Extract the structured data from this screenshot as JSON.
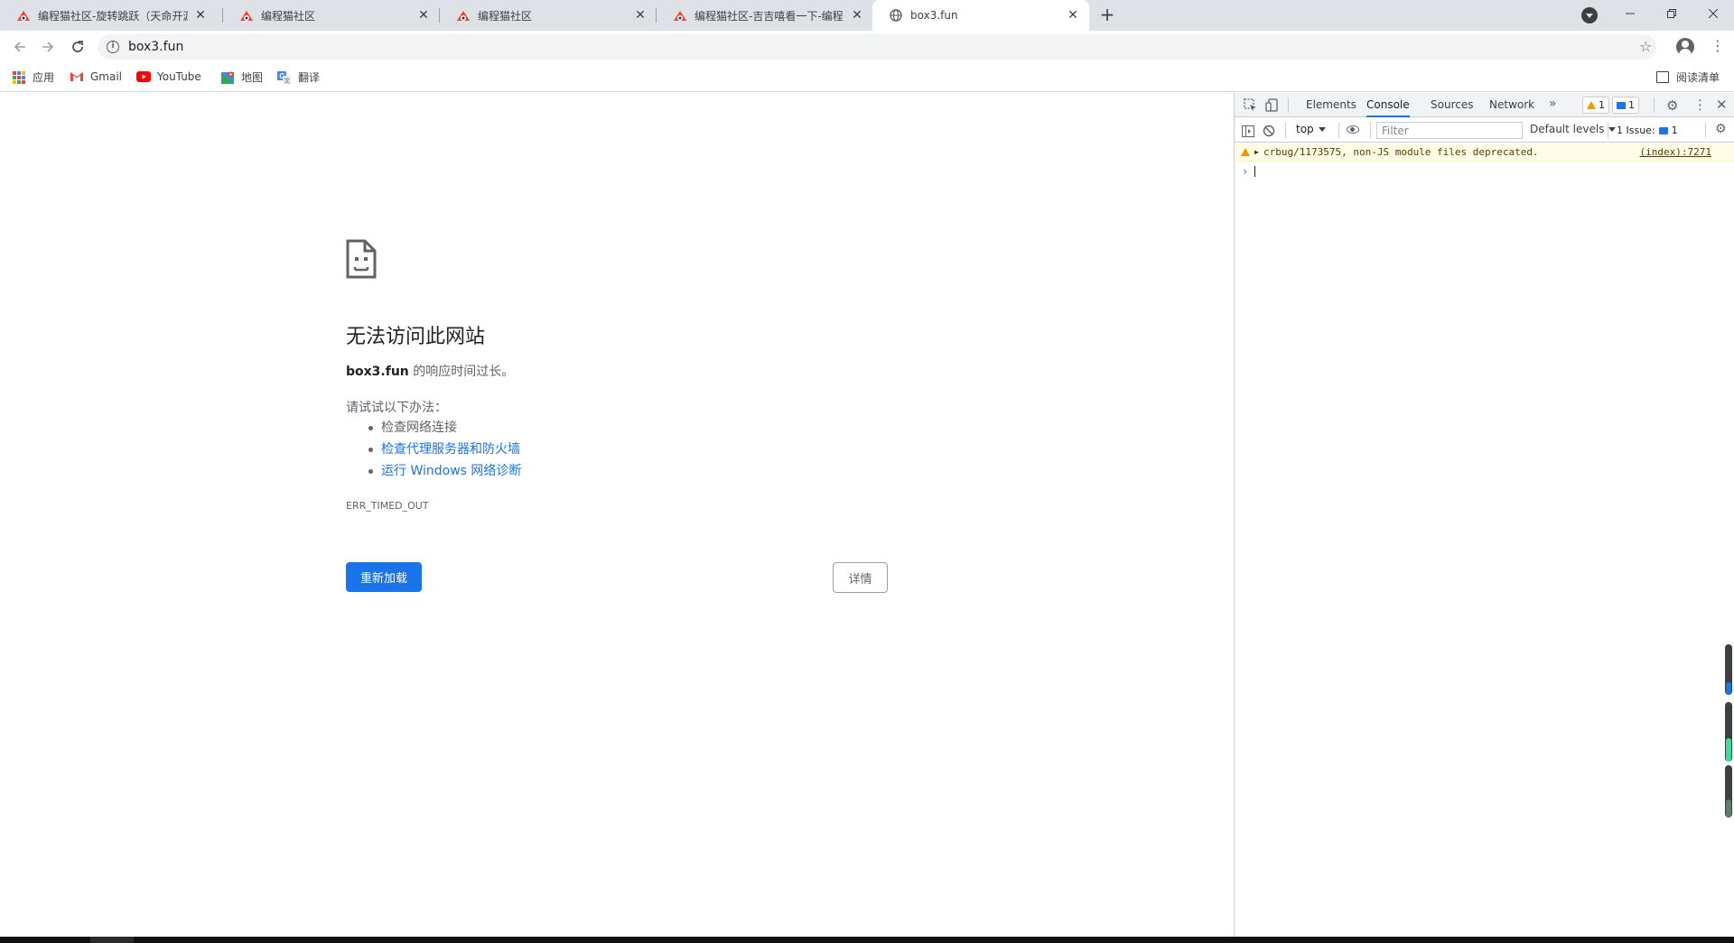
{
  "tabs": [
    {
      "title": "编程猫社区-旋转跳跃（天命开源",
      "active": false,
      "favicon": "codemao-icon"
    },
    {
      "title": "编程猫社区",
      "active": false,
      "favicon": "codemao-icon"
    },
    {
      "title": "编程猫社区",
      "active": false,
      "favicon": "codemao-icon"
    },
    {
      "title": "编程猫社区-吉吉嘻看一下-编程",
      "active": false,
      "favicon": "codemao-icon"
    },
    {
      "title": "box3.fun",
      "active": true,
      "favicon": "globe-icon"
    }
  ],
  "toolbar": {
    "url": "box3.fun"
  },
  "bookmarks": [
    {
      "label": "应用",
      "icon": "apps-grid-icon"
    },
    {
      "label": "Gmail",
      "icon": "gmail-icon"
    },
    {
      "label": "YouTube",
      "icon": "youtube-icon"
    },
    {
      "label": "地图",
      "icon": "maps-icon"
    },
    {
      "label": "翻译",
      "icon": "translate-icon"
    }
  ],
  "reading_list": "阅读清单",
  "error_page": {
    "title": "无法访问此网站",
    "host": "box3.fun",
    "desc_suffix": " 的响应时间过长。",
    "try_label": "请试试以下办法：",
    "suggestions": [
      {
        "text": "检查网络连接",
        "link": false
      },
      {
        "text": "检查代理服务器和防火墙",
        "link": true
      },
      {
        "text": "运行 Windows 网络诊断",
        "link": true
      }
    ],
    "error_code": "ERR_TIMED_OUT",
    "reload_label": "重新加载",
    "details_label": "详情"
  },
  "devtools": {
    "tabs": [
      "Elements",
      "Console",
      "Sources",
      "Network"
    ],
    "active_tab": "Console",
    "warnings_count": "1",
    "messages_count": "1",
    "context": "top",
    "filter_placeholder": "Filter",
    "levels": "Default levels",
    "issues_label": "1 Issue:",
    "issues_count": "1",
    "console": [
      {
        "level": "warning",
        "text": "crbug/1173575, non-JS module files deprecated.",
        "source": "(index):7271"
      }
    ]
  },
  "colors": {
    "accent": "#1a73e8",
    "warning": "#f29900",
    "tabstrip": "#dee1e6"
  }
}
